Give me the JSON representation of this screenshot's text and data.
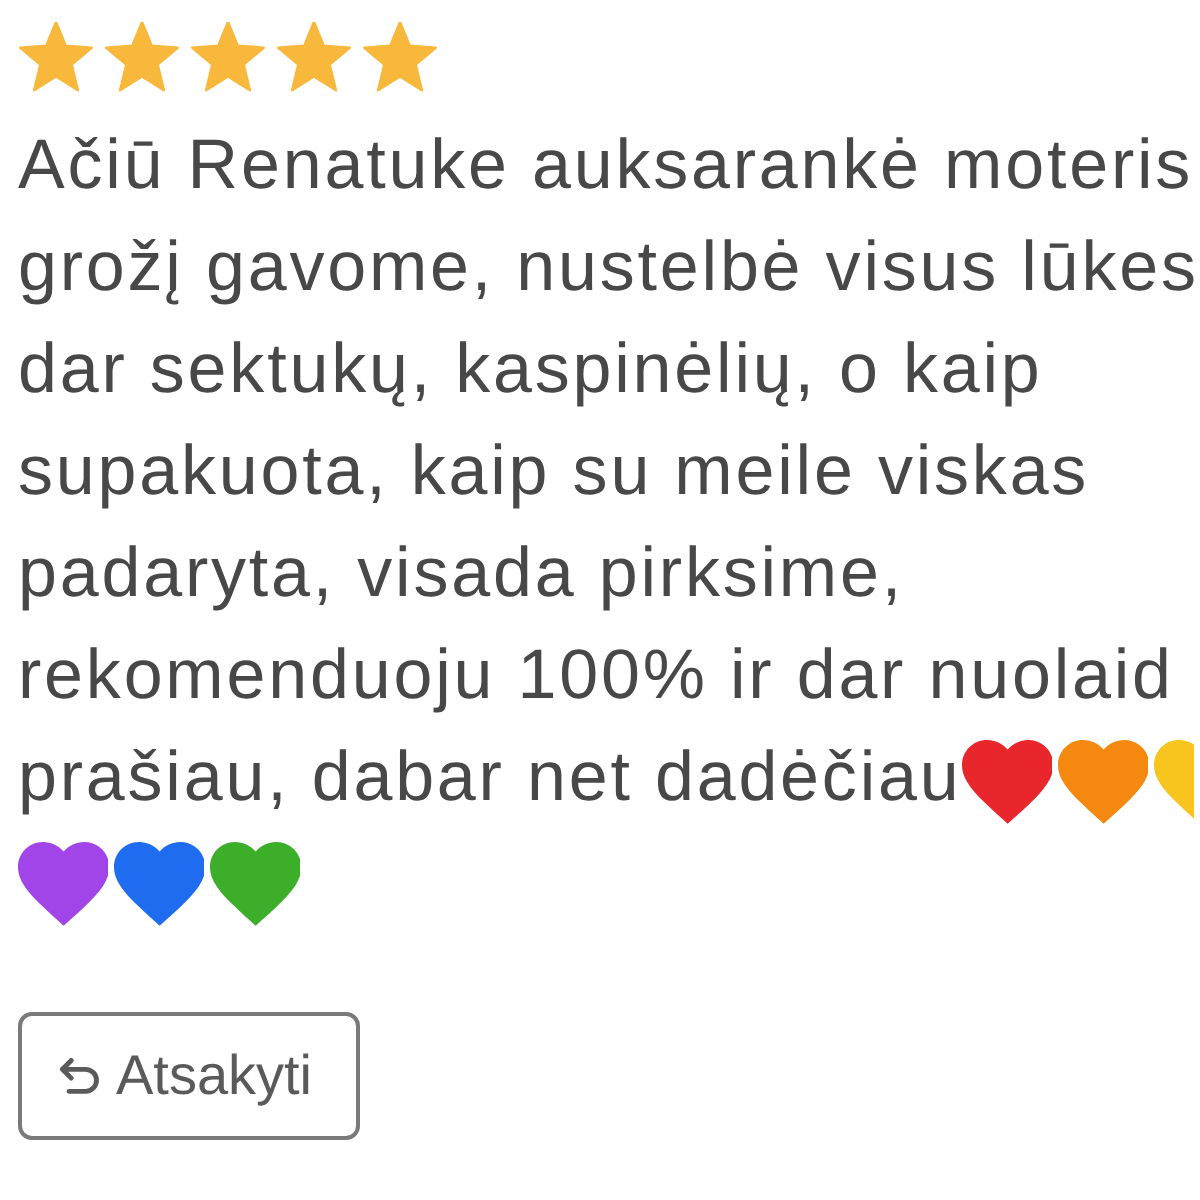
{
  "rating": {
    "stars": 5
  },
  "review": {
    "lines": [
      {
        "text": "Ačiū Renatuke auksarankė moteris"
      },
      {
        "text": "grožį gavome, nustelbė visus lūkes"
      },
      {
        "text": "dar sektukų, kaspinėlių, o kaip"
      },
      {
        "text": "supakuota, kaip su meile viskas"
      },
      {
        "text": "padaryta, visada pirksime,"
      },
      {
        "text": "rekomenduoju 100% ir dar nuolaid"
      },
      {
        "text": "prašiau, dabar net dadėčiau",
        "hearts": [
          {
            "color": "#e8262b"
          },
          {
            "color": "#f5880f"
          },
          {
            "color": "#f7c51e"
          }
        ]
      },
      {
        "hearts": [
          {
            "color": "#a144e8"
          },
          {
            "color": "#1f6cf0"
          },
          {
            "color": "#3cae2a"
          }
        ]
      }
    ]
  },
  "reply_button": {
    "label": "Atsakyti"
  }
}
